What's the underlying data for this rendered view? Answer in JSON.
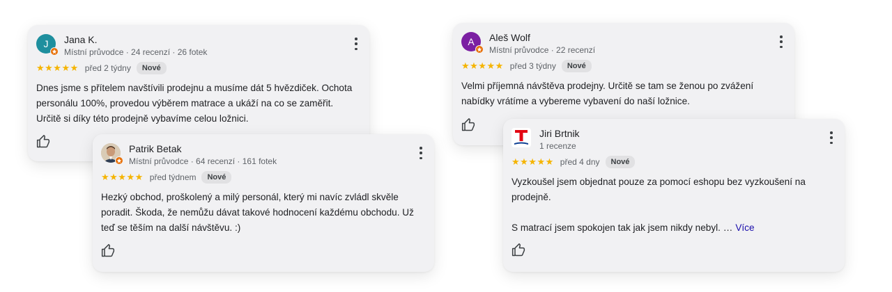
{
  "reviews": [
    {
      "author": "Jana K.",
      "meta": "Místní průvodce · 24 recenzí · 26 fotek",
      "avatar_initial": "J",
      "avatar_color": "#1e8f9e",
      "stars": "★★★★★",
      "date": "před 2 týdny",
      "badge": "Nové",
      "text": [
        "Dnes jsme s přítelem navštívili prodejnu a musíme dát 5 hvězdiček. Ochota personálu 100%, provedou výběrem matrace a ukáží na co se zaměřit. Určitě si díky této prodejně vybavíme celou ložnici."
      ]
    },
    {
      "author": "Patrik Betak",
      "meta": "Místní průvodce · 64 recenzí · 161 fotek",
      "stars": "★★★★★",
      "date": "před týdnem",
      "badge": "Nové",
      "text": [
        "Hezký obchod, proškolený a milý personál, který mi navíc zvládl skvěle poradit. Škoda, že nemůžu dávat takové hodnocení každému obchodu. Už teď se těším na další návštěvu. :)"
      ]
    },
    {
      "author": "Aleš Wolf",
      "meta": "Místní průvodce · 22 recenzí",
      "avatar_initial": "A",
      "avatar_color": "#7b1fa2",
      "stars": "★★★★★",
      "date": "před 3 týdny",
      "badge": "Nové",
      "text": [
        "Velmi příjemná návštěva prodejny. Určitě se tam se ženou po zvážení nabídky vrátíme a vybereme vybavení do naší ložnice."
      ]
    },
    {
      "author": "Jiri Brtnik",
      "meta": "1 recenze",
      "stars": "★★★★★",
      "date": "před 4 dny",
      "badge": "Nové",
      "text": [
        "Vyzkoušel jsem objednat pouze za pomocí eshopu bez vyzkoušení na prodejně.",
        "S matrací jsem spokojen tak jak jsem nikdy nebyl. …"
      ],
      "more": "Více"
    }
  ],
  "colors": {
    "star": "#f5b400",
    "guide_badge": "#e8710a",
    "logo_red": "#e30613",
    "logo_blue": "#0c3d91"
  }
}
